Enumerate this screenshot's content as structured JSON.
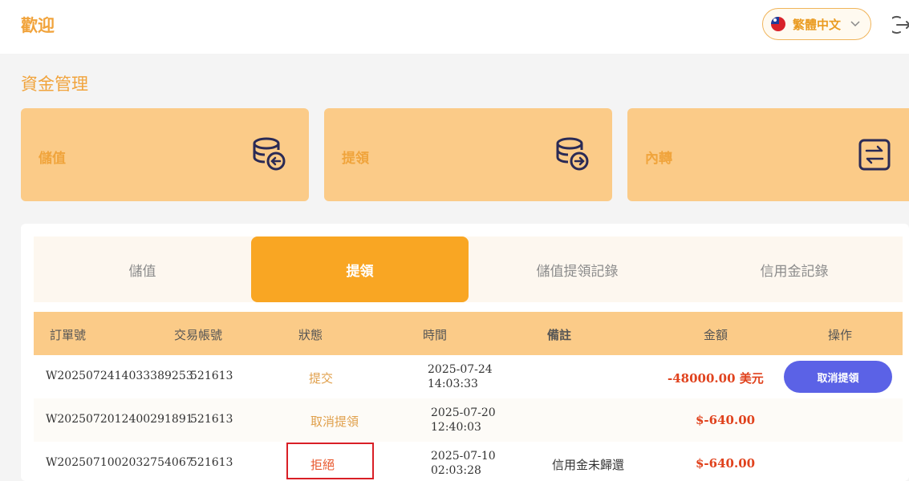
{
  "header": {
    "brand": "歡迎",
    "language": "繁體中文"
  },
  "page": {
    "title": "資金管理"
  },
  "cards": [
    {
      "label": "儲值",
      "icon": "coins-deposit-icon"
    },
    {
      "label": "提領",
      "icon": "coins-withdraw-icon"
    },
    {
      "label": "內轉",
      "icon": "transfer-arrows-icon"
    }
  ],
  "tabs": [
    {
      "label": "儲值",
      "active": false
    },
    {
      "label": "提領",
      "active": true
    },
    {
      "label": "儲值提領記錄",
      "active": false
    },
    {
      "label": "信用金記錄",
      "active": false
    }
  ],
  "table": {
    "columns": [
      "訂單號",
      "交易帳號",
      "狀態",
      "時間",
      "備註",
      "金額",
      "操作"
    ],
    "rows": [
      {
        "order": "W2025072414033389253",
        "account": "521613",
        "status": "提交",
        "date": "2025-07-24",
        "time": "14:03:33",
        "note": "",
        "amount": "-48000.00 美元",
        "action": "取消提領"
      },
      {
        "order": "W2025072012400291891",
        "account": "521613",
        "status": "取消提領",
        "date": "2025-07-20",
        "time": "12:40:03",
        "note": "",
        "amount": "$-640.00",
        "action": ""
      },
      {
        "order": "W2025071002032754067",
        "account": "521613",
        "status": "拒絕",
        "date": "2025-07-10",
        "time": "02:03:28",
        "note": "信用金未歸還",
        "amount": "$-640.00",
        "action": ""
      }
    ]
  },
  "colors": {
    "accent": "#f9a623",
    "card_bg": "#fbcb88",
    "button": "#5b62e6",
    "amount": "#e0421d",
    "highlight": "#d91f26"
  }
}
